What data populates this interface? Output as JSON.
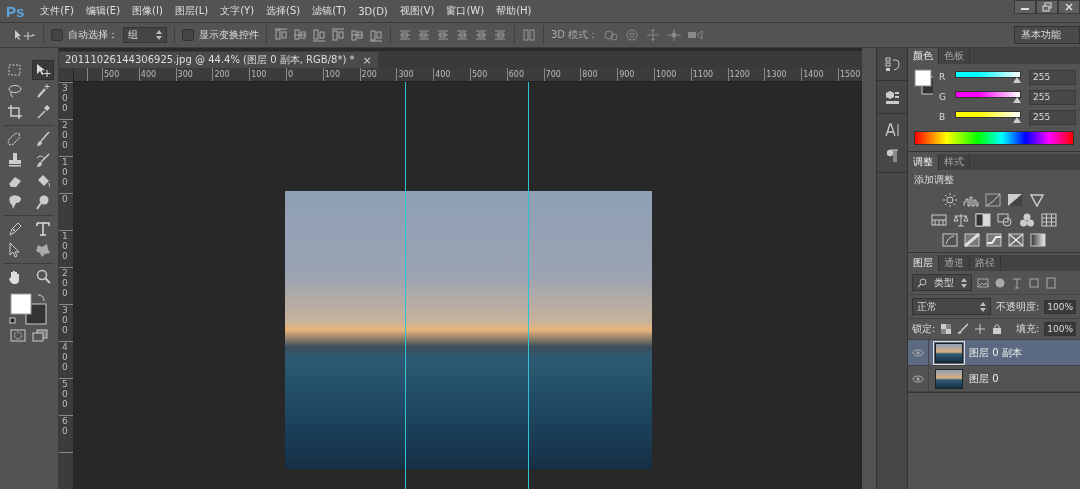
{
  "menu_bar": {
    "logo": "Ps",
    "items": [
      "文件(F)",
      "编辑(E)",
      "图像(I)",
      "图层(L)",
      "文字(Y)",
      "选择(S)",
      "滤镜(T)",
      "3D(D)",
      "视图(V)",
      "窗口(W)",
      "帮助(H)"
    ]
  },
  "options_bar": {
    "auto_select": {
      "label": "自动选择：",
      "checked": false
    },
    "auto_select_target": "组",
    "show_transform": {
      "label": "显示变换控件",
      "checked": false
    },
    "mode_3d_label": "3D 模式：",
    "workspace": "基本功能"
  },
  "document_tab": {
    "title": "20111026144306925.jpg @ 44.4% (图层 0 副本, RGB/8*) *",
    "close": "×"
  },
  "rulers": {
    "horizontal": [
      "500",
      "400",
      "300",
      "200",
      "100",
      "0",
      "100",
      "200",
      "300",
      "400",
      "500",
      "600",
      "700",
      "800",
      "900",
      "1000",
      "1100",
      "1200",
      "1300",
      "1400",
      "1500"
    ],
    "vertical": [
      "300",
      "200",
      "100",
      "0",
      "100",
      "200",
      "300",
      "400",
      "500",
      "60"
    ]
  },
  "toolbox": [
    {
      "kind": "marquee",
      "selected": false
    },
    {
      "kind": "move",
      "selected": true
    },
    {
      "kind": "lasso",
      "selected": false
    },
    {
      "kind": "wand",
      "selected": false
    },
    {
      "kind": "crop",
      "selected": false
    },
    {
      "kind": "eyedropper",
      "selected": false
    },
    {
      "kind": "healing",
      "selected": false
    },
    {
      "kind": "brush",
      "selected": false
    },
    {
      "kind": "stamp",
      "selected": false
    },
    {
      "kind": "history",
      "selected": false
    },
    {
      "kind": "eraser",
      "selected": false
    },
    {
      "kind": "bucket",
      "selected": false
    },
    {
      "kind": "blur",
      "selected": false
    },
    {
      "kind": "dodge",
      "selected": false
    },
    {
      "kind": "pen",
      "selected": false
    },
    {
      "kind": "type",
      "selected": false
    },
    {
      "kind": "pathselect",
      "selected": false
    },
    {
      "kind": "shape",
      "selected": false
    },
    {
      "kind": "hand",
      "selected": false
    },
    {
      "kind": "zoom",
      "selected": false
    }
  ],
  "color_panel": {
    "tabs": [
      {
        "label": "颜色",
        "selected": true
      },
      {
        "label": "色板",
        "selected": false
      }
    ],
    "channels": [
      {
        "label": "R",
        "value": "255",
        "level": 1,
        "color": "#00ffff"
      },
      {
        "label": "G",
        "value": "255",
        "level": 1,
        "color": "#ff00ff"
      },
      {
        "label": "B",
        "value": "255",
        "level": 1,
        "color": "#ffff00"
      }
    ]
  },
  "adjustments_panel": {
    "tabs": [
      {
        "label": "调整",
        "selected": true
      },
      {
        "label": "样式",
        "selected": false
      }
    ],
    "heading": "添加调整"
  },
  "layers_panel": {
    "tabs": [
      {
        "label": "图层",
        "selected": true
      },
      {
        "label": "通道",
        "selected": false
      },
      {
        "label": "路径",
        "selected": false
      }
    ],
    "filter": "类型",
    "blend_mode": "正常",
    "opacity_label": "不透明度:",
    "opacity": "100%",
    "lock_label": "锁定:",
    "fill_label": "填充:",
    "fill": "100%",
    "layers": [
      {
        "name": "图层 0 副本",
        "selected": true,
        "visible": true
      },
      {
        "name": "图层 0",
        "selected": false,
        "visible": true
      }
    ]
  }
}
